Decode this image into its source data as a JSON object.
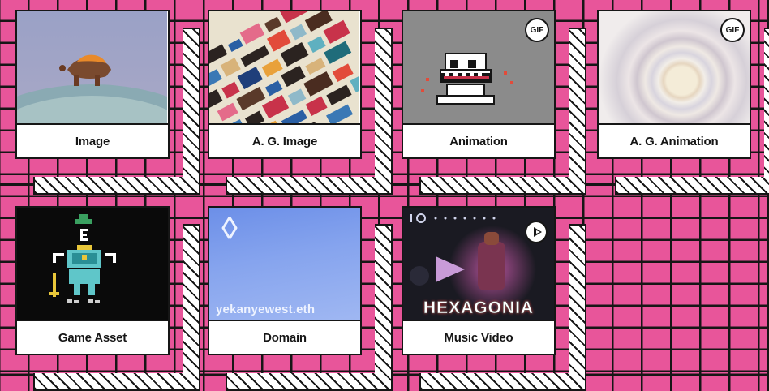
{
  "cards": [
    {
      "label": "Image",
      "badge": "",
      "icon": "image-thumbnail"
    },
    {
      "label": "A. G. Image",
      "badge": "",
      "icon": "generative-image-thumbnail"
    },
    {
      "label": "Animation",
      "badge": "GIF",
      "icon": "pixel-skull-thumbnail"
    },
    {
      "label": "A. G. Animation",
      "badge": "GIF",
      "icon": "radial-blur-thumbnail"
    },
    {
      "label": "Game Asset",
      "badge": "",
      "icon": "pixel-character-thumbnail"
    },
    {
      "label": "Domain",
      "badge": "",
      "icon": "ens-logo-thumbnail",
      "overlay_text": "yekanyewest.eth"
    },
    {
      "label": "Music Video",
      "badge": "",
      "icon": "play-icon",
      "overlay_text": "HEXAGONIA"
    }
  ],
  "colors": {
    "background": "#e8559a",
    "grid_lines": "#161616",
    "card": "#ffffff"
  }
}
